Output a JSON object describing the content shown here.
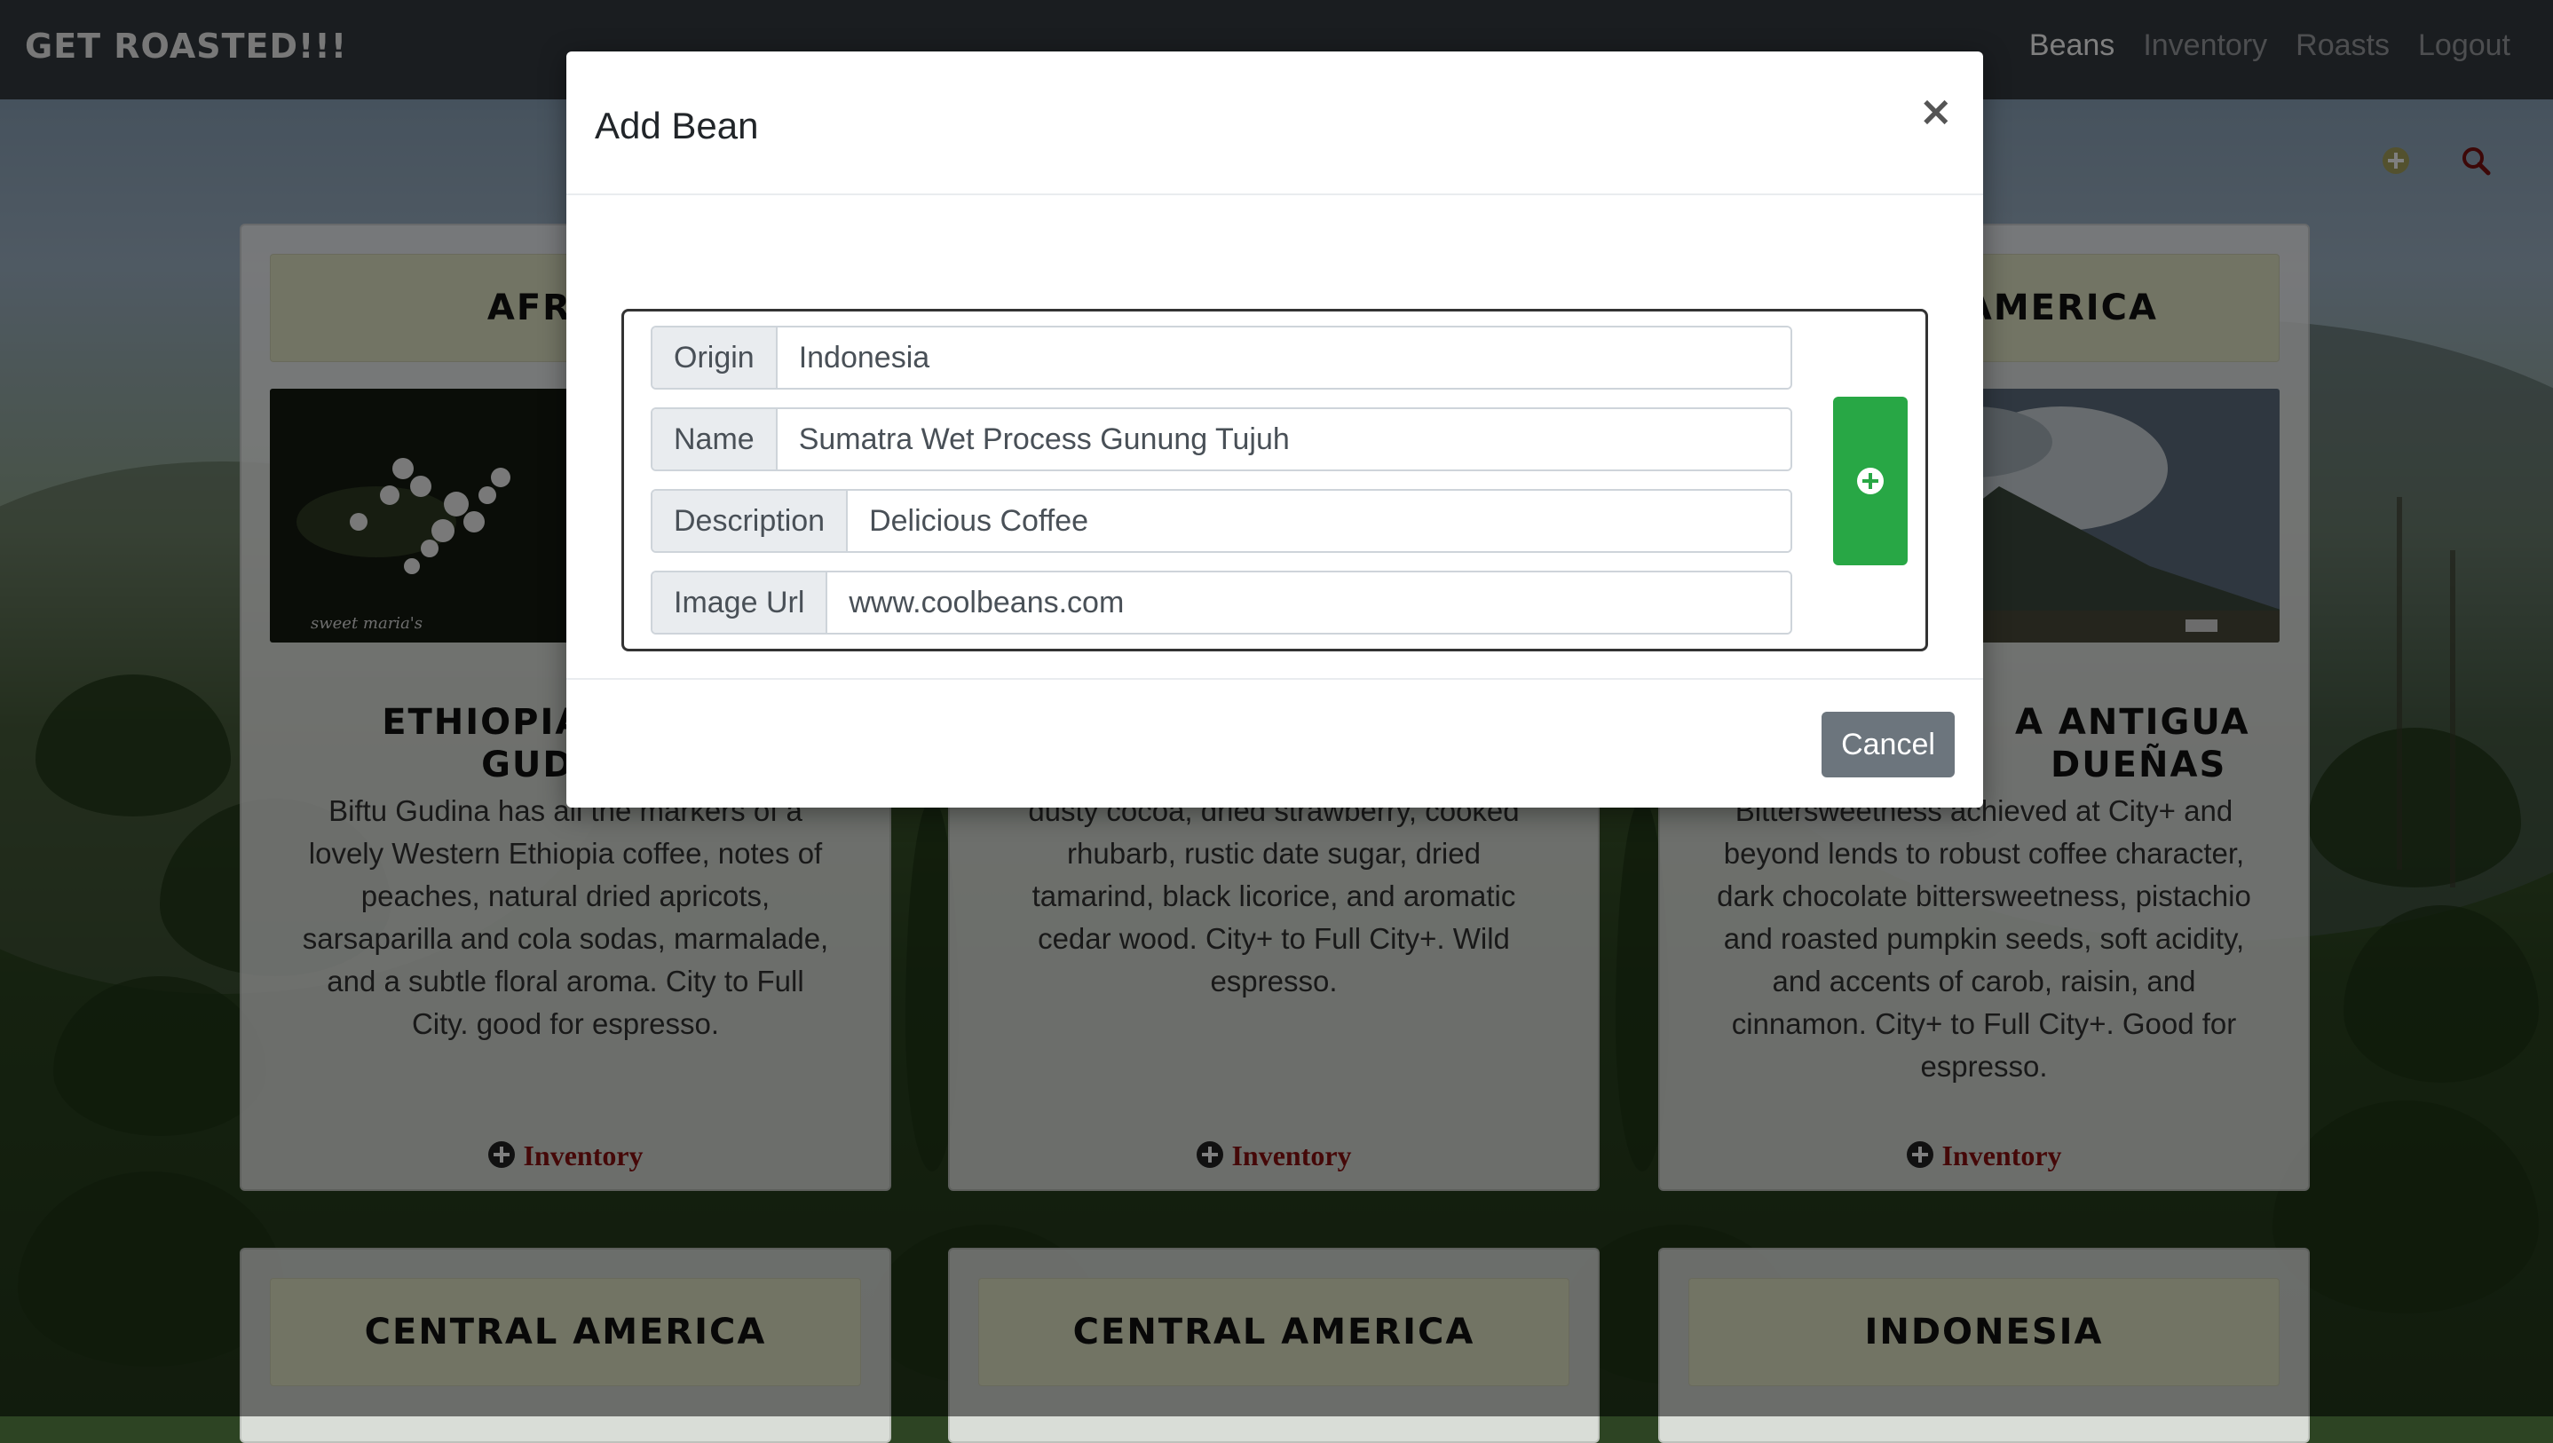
{
  "navbar": {
    "brand": "GET ROASTED!!!",
    "links": [
      "Beans",
      "Inventory",
      "Roasts",
      "Logout"
    ]
  },
  "toolbar": {
    "add_icon": "plus-circle-icon",
    "search_icon": "search-icon"
  },
  "cards_row1": [
    {
      "region": "AFRICA",
      "title_line1": "ETHIOPIA AGARO",
      "title_line2": "GUDINA",
      "description": "Biftu Gudina has all the markers of a lovely Western Ethiopia coffee, notes of peaches, natural dried apricots, sarsaparilla and cola sodas, marmalade, and a subtle floral aroma. City to Full City. good for espresso.",
      "image_caption": "sweet maria's",
      "link": "Inventory"
    },
    {
      "region": "",
      "title_line1": "",
      "title_line2": "",
      "description": "dusty cocoa, dried strawberry, cooked rhubarb, rustic date sugar, dried tamarind, black licorice, and aromatic cedar wood. City+ to Full City+. Wild espresso.",
      "link": "Inventory"
    },
    {
      "region": "AMERICA",
      "title_line1": "A ANTIGUA",
      "title_line2": "DUEÑAS",
      "description": "Bittersweetness achieved at City+ and beyond lends to robust coffee character, dark chocolate bittersweetness, pistachio and roasted pumpkin seeds, soft acidity, and accents of carob, raisin, and cinnamon. City+ to Full City+. Good for espresso.",
      "link": "Inventory"
    }
  ],
  "cards_row2": [
    {
      "region": "CENTRAL AMERICA"
    },
    {
      "region": "CENTRAL AMERICA"
    },
    {
      "region": "INDONESIA"
    }
  ],
  "modal": {
    "title": "Add Bean",
    "close": "×",
    "fields": [
      {
        "label": "Origin",
        "value": "Indonesia"
      },
      {
        "label": "Name",
        "value": "Sumatra Wet Process Gunung Tujuh"
      },
      {
        "label": "Description",
        "value": "Delicious Coffee"
      },
      {
        "label": "Image Url",
        "value": "www.coolbeans.com"
      }
    ],
    "add_icon": "plus-circle-icon",
    "cancel": "Cancel"
  },
  "colors": {
    "navbar": "#343a40",
    "success": "#28a745",
    "secondary": "#6c757d",
    "link": "#8b1010",
    "card_header": "#e4e8c8"
  }
}
